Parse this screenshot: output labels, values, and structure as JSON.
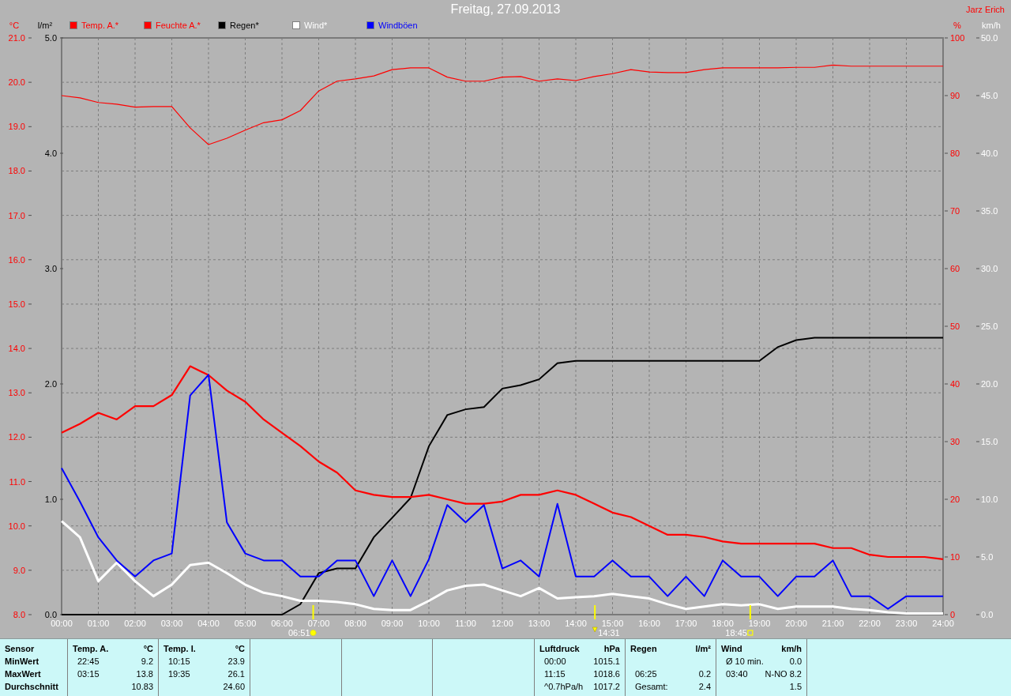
{
  "author": "Jarz Erich",
  "chart": {
    "chart_data": {
      "type": "line",
      "title": "Freitag, 27.09.2013",
      "x": [
        0,
        0.5,
        1,
        1.5,
        2,
        2.5,
        3,
        3.5,
        4,
        4.5,
        5,
        5.5,
        6,
        6.5,
        7,
        7.5,
        8,
        8.5,
        9,
        9.5,
        10,
        10.5,
        11,
        11.5,
        12,
        12.5,
        13,
        13.5,
        14,
        14.5,
        15,
        15.5,
        16,
        16.5,
        17,
        17.5,
        18,
        18.5,
        19,
        19.5,
        20,
        20.5,
        21,
        21.5,
        22,
        22.5,
        23,
        23.5,
        24
      ],
      "xlim": [
        0,
        24
      ],
      "grid": true,
      "xticks": [
        {
          "value": 0,
          "label": "00:00"
        },
        {
          "value": 1,
          "label": "01:00"
        },
        {
          "value": 2,
          "label": "02:00"
        },
        {
          "value": 3,
          "label": "03:00"
        },
        {
          "value": 4,
          "label": "04:00"
        },
        {
          "value": 5,
          "label": "05:00"
        },
        {
          "value": 6,
          "label": "06:00"
        },
        {
          "value": 7,
          "label": "07:00"
        },
        {
          "value": 8,
          "label": "08:00"
        },
        {
          "value": 9,
          "label": "09:00"
        },
        {
          "value": 10,
          "label": "10:00"
        },
        {
          "value": 11,
          "label": "11:00"
        },
        {
          "value": 12,
          "label": "12:00"
        },
        {
          "value": 13,
          "label": "13:00"
        },
        {
          "value": 14,
          "label": "14:00"
        },
        {
          "value": 15,
          "label": "15:00"
        },
        {
          "value": 16,
          "label": "16:00"
        },
        {
          "value": 17,
          "label": "17:00"
        },
        {
          "value": 18,
          "label": "18:00"
        },
        {
          "value": 19,
          "label": "19:00"
        },
        {
          "value": 20,
          "label": "20:00"
        },
        {
          "value": 21,
          "label": "21:00"
        },
        {
          "value": 22,
          "label": "22:00"
        },
        {
          "value": 23,
          "label": "23:00"
        },
        {
          "value": 24,
          "label": "24:00"
        }
      ],
      "ylabel": "°C",
      "ylim": [
        8,
        21
      ],
      "yticks": [
        {
          "value": 8,
          "label": "8.0"
        },
        {
          "value": 9,
          "label": "9.0"
        },
        {
          "value": 10,
          "label": "10.0"
        },
        {
          "value": 11,
          "label": "11.0"
        },
        {
          "value": 12,
          "label": "12.0"
        },
        {
          "value": 13,
          "label": "13.0"
        },
        {
          "value": 14,
          "label": "14.0"
        },
        {
          "value": 15,
          "label": "15.0"
        },
        {
          "value": 16,
          "label": "16.0"
        },
        {
          "value": 17,
          "label": "17.0"
        },
        {
          "value": 18,
          "label": "18.0"
        },
        {
          "value": 19,
          "label": "19.0"
        },
        {
          "value": 20,
          "label": "20.0"
        },
        {
          "value": 21,
          "label": "21.0"
        }
      ],
      "y2label": "%",
      "y2lim": [
        0,
        100
      ],
      "y2ticks": [
        {
          "value": 0,
          "label": "0"
        },
        {
          "value": 10,
          "label": "10"
        },
        {
          "value": 20,
          "label": "20"
        },
        {
          "value": 30,
          "label": "30"
        },
        {
          "value": 40,
          "label": "40"
        },
        {
          "value": 50,
          "label": "50"
        },
        {
          "value": 60,
          "label": "60"
        },
        {
          "value": 70,
          "label": "70"
        },
        {
          "value": 80,
          "label": "80"
        },
        {
          "value": 90,
          "label": "90"
        },
        {
          "value": 100,
          "label": "100"
        }
      ],
      "y3label": "km/h",
      "y3lim": [
        0,
        50
      ],
      "y3ticks": [
        {
          "value": 0,
          "label": "0.0"
        },
        {
          "value": 5,
          "label": "5.0"
        },
        {
          "value": 10,
          "label": "10.0"
        },
        {
          "value": 15,
          "label": "15.0"
        },
        {
          "value": 20,
          "label": "20.0"
        },
        {
          "value": 25,
          "label": "25.0"
        },
        {
          "value": 30,
          "label": "30.0"
        },
        {
          "value": 35,
          "label": "35.0"
        },
        {
          "value": 40,
          "label": "40.0"
        },
        {
          "value": 45,
          "label": "45.0"
        },
        {
          "value": 50,
          "label": "50.0"
        }
      ],
      "series": [
        {
          "name": "Temp. A.*",
          "color": "#ff0000",
          "values": [
            12.1,
            12.3,
            12.55,
            12.4,
            12.7,
            12.7,
            12.95,
            13.6,
            13.4,
            13.05,
            12.8,
            12.4,
            12.1,
            11.8,
            11.45,
            11.2,
            10.8,
            10.7,
            10.65,
            10.65,
            10.7,
            10.6,
            10.5,
            10.5,
            10.55,
            10.7,
            10.7,
            10.8,
            10.7,
            10.5,
            10.3,
            10.2,
            10.0,
            9.8,
            9.8,
            9.75,
            9.65,
            9.6,
            9.6,
            9.6,
            9.6,
            9.6,
            9.5,
            9.5,
            9.35,
            9.3,
            9.3,
            9.3,
            9.25
          ]
        },
        {
          "name": "Feuchte A.*",
          "color": "#ff0000",
          "axis": "y2",
          "values": [
            90,
            89.6,
            88.8,
            88.5,
            88,
            88.1,
            88.1,
            84.4,
            81.5,
            82.6,
            84,
            85.3,
            85.8,
            87.4,
            90.8,
            92.5,
            92.9,
            93.4,
            94.5,
            94.8,
            94.8,
            93.2,
            92.5,
            92.5,
            93.2,
            93.3,
            92.5,
            92.9,
            92.6,
            93.3,
            93.8,
            94.5,
            94.1,
            94,
            94,
            94.5,
            94.8,
            94.8,
            94.8,
            94.8,
            94.9,
            94.9,
            95.3,
            95.1,
            95.1,
            95.1,
            95.1,
            95.1,
            95.1
          ]
        },
        {
          "name": "Wind*",
          "color": "#ffffff",
          "axis": "y3",
          "values": [
            8.1,
            6.7,
            2.9,
            4.5,
            2.9,
            1.6,
            2.6,
            4.3,
            4.5,
            3.6,
            2.6,
            1.9,
            1.6,
            1.2,
            1.2,
            1.1,
            0.9,
            0.5,
            0.4,
            0.4,
            1.2,
            2.1,
            2.5,
            2.6,
            2.1,
            1.6,
            2.3,
            1.4,
            1.5,
            1.6,
            1.8,
            1.6,
            1.4,
            0.9,
            0.5,
            0.7,
            0.9,
            0.8,
            0.9,
            0.5,
            0.7,
            0.7,
            0.7,
            0.5,
            0.4,
            0.2,
            0.1,
            0.1,
            0.1
          ]
        },
        {
          "name": "Windböen",
          "color": "#0000ff",
          "axis": "y3",
          "values": [
            12.7,
            9.8,
            6.7,
            4.7,
            3.3,
            4.7,
            5.3,
            19,
            20.8,
            8,
            5.3,
            4.7,
            4.7,
            3.3,
            3.3,
            4.7,
            4.7,
            1.6,
            4.7,
            1.6,
            4.8,
            9.5,
            8,
            9.5,
            4,
            4.7,
            3.3,
            9.6,
            3.3,
            3.3,
            4.7,
            3.3,
            3.3,
            1.6,
            3.3,
            1.6,
            4.7,
            3.3,
            3.3,
            1.6,
            3.3,
            3.3,
            4.7,
            1.6,
            1.6,
            0.5,
            1.6,
            1.6,
            1.6
          ]
        }
      ]
    },
    "markers": [
      {
        "kind": "sunrise",
        "label": "06:51"
      },
      {
        "kind": "noon",
        "label": "14:31"
      },
      {
        "kind": "sunset",
        "label": "18:45"
      }
    ]
  },
  "rain_chart": {
    "chart_data": {
      "type": "line",
      "x": [
        0,
        0.5,
        1,
        1.5,
        2,
        2.5,
        3,
        3.5,
        4,
        4.5,
        5,
        5.5,
        6,
        6.5,
        7,
        7.5,
        8,
        8.5,
        9,
        9.5,
        10,
        10.5,
        11,
        11.5,
        12,
        12.5,
        13,
        13.5,
        14,
        14.5,
        15,
        15.5,
        16,
        16.5,
        17,
        17.5,
        18,
        18.5,
        19,
        19.5,
        20,
        20.5,
        21,
        21.5,
        22,
        22.5,
        23,
        23.5,
        24
      ],
      "xlim": [
        0,
        24
      ],
      "ylabel": "l/m²",
      "ylim": [
        0,
        5
      ],
      "yticks": [
        {
          "value": 0,
          "label": "0.0"
        },
        {
          "value": 1,
          "label": "1.0"
        },
        {
          "value": 2,
          "label": "2.0"
        },
        {
          "value": 3,
          "label": "3.0"
        },
        {
          "value": 4,
          "label": "4.0"
        },
        {
          "value": 5,
          "label": "5.0"
        }
      ],
      "series": [
        {
          "name": "Regen*",
          "color": "#000000",
          "values": [
            0,
            0,
            0,
            0,
            0,
            0,
            0,
            0,
            0,
            0,
            0,
            0,
            0,
            0.09,
            0.36,
            0.4,
            0.4,
            0.67,
            0.84,
            1.01,
            1.46,
            1.73,
            1.78,
            1.8,
            1.96,
            1.99,
            2.04,
            2.18,
            2.2,
            2.2,
            2.2,
            2.2,
            2.2,
            2.2,
            2.2,
            2.2,
            2.2,
            2.2,
            2.2,
            2.32,
            2.38,
            2.4,
            2.4,
            2.4,
            2.4,
            2.4,
            2.4,
            2.4,
            2.4
          ]
        }
      ]
    }
  },
  "stats": {
    "row_labels": [
      "Sensor",
      "MinWert",
      "MaxWert",
      "Durchschnitt"
    ],
    "columns": [
      {
        "kind": "data",
        "name": "Temp. A.",
        "unit": "°C",
        "rows": [
          {
            "time": "22:45",
            "value": "9.2"
          },
          {
            "time": "03:15",
            "value": "13.8"
          },
          {
            "value": "10.83"
          }
        ]
      },
      {
        "kind": "data",
        "name": "Temp. I.",
        "unit": "°C",
        "rows": [
          {
            "time": "10:15",
            "value": "23.9"
          },
          {
            "time": "19:35",
            "value": "26.1"
          },
          {
            "value": "24.60"
          }
        ]
      },
      {
        "kind": "blank"
      },
      {
        "kind": "blank"
      },
      {
        "kind": "blank"
      },
      {
        "kind": "data",
        "name": "Luftdruck",
        "unit": "hPa",
        "rows": [
          {
            "time": "00:00",
            "value": "1015.1"
          },
          {
            "time": "11:15",
            "value": "1018.6"
          },
          {
            "time": "^0.7hPa/h",
            "value": "1017.2"
          }
        ]
      },
      {
        "kind": "data",
        "name": "Regen",
        "unit": "l/m²",
        "rows": [
          {},
          {
            "time": "06:25",
            "value": "0.2"
          },
          {
            "time": "Gesamt:",
            "value": "2.4"
          }
        ]
      },
      {
        "kind": "data",
        "name": "Wind",
        "unit": "km/h",
        "rows": [
          {
            "time": "Ø 10 min.",
            "value": "0.0"
          },
          {
            "time": "03:40",
            "value": "N-NO 8.2"
          },
          {
            "value": "1.5"
          }
        ]
      }
    ]
  }
}
